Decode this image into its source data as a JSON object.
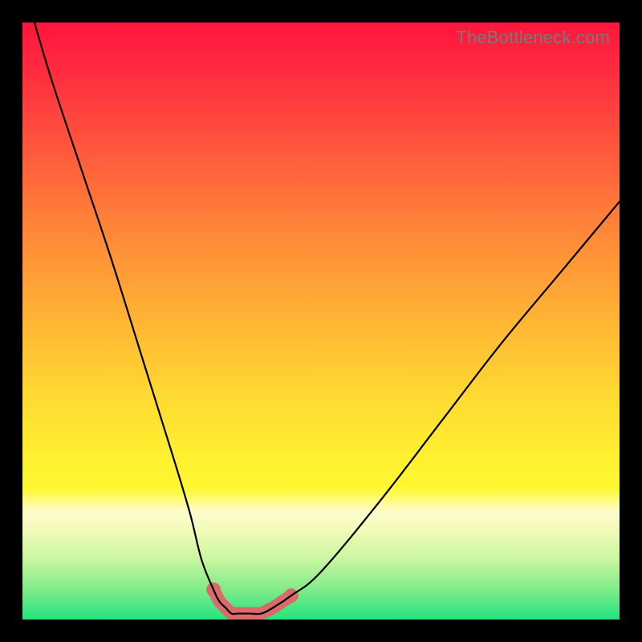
{
  "watermark": "TheBottleneck.com",
  "chart_data": {
    "type": "line",
    "title": "",
    "xlabel": "",
    "ylabel": "",
    "xlim": [
      0,
      100
    ],
    "ylim": [
      0,
      100
    ],
    "series": [
      {
        "name": "bottleneck-curve",
        "color": "#000000",
        "x": [
          2,
          5,
          10,
          15,
          20,
          25,
          28,
          30,
          32,
          33,
          34,
          35,
          36,
          38,
          40,
          42,
          45,
          50,
          60,
          70,
          80,
          90,
          100
        ],
        "values": [
          100,
          90,
          75,
          60,
          44,
          28,
          18,
          10,
          5,
          3,
          2,
          1,
          1,
          1,
          1,
          2,
          4,
          8,
          20,
          33,
          46,
          58,
          70
        ]
      },
      {
        "name": "optimal-range-marker",
        "color": "#db6b6b",
        "x_range": [
          32,
          45
        ],
        "y_level": 1,
        "note": "flat minimum zone highlighted with thick pink stroke and end dots"
      }
    ],
    "gradient_meaning": "background gradient from red (high bottleneck) at top to green (no bottleneck) at bottom",
    "annotations": []
  }
}
